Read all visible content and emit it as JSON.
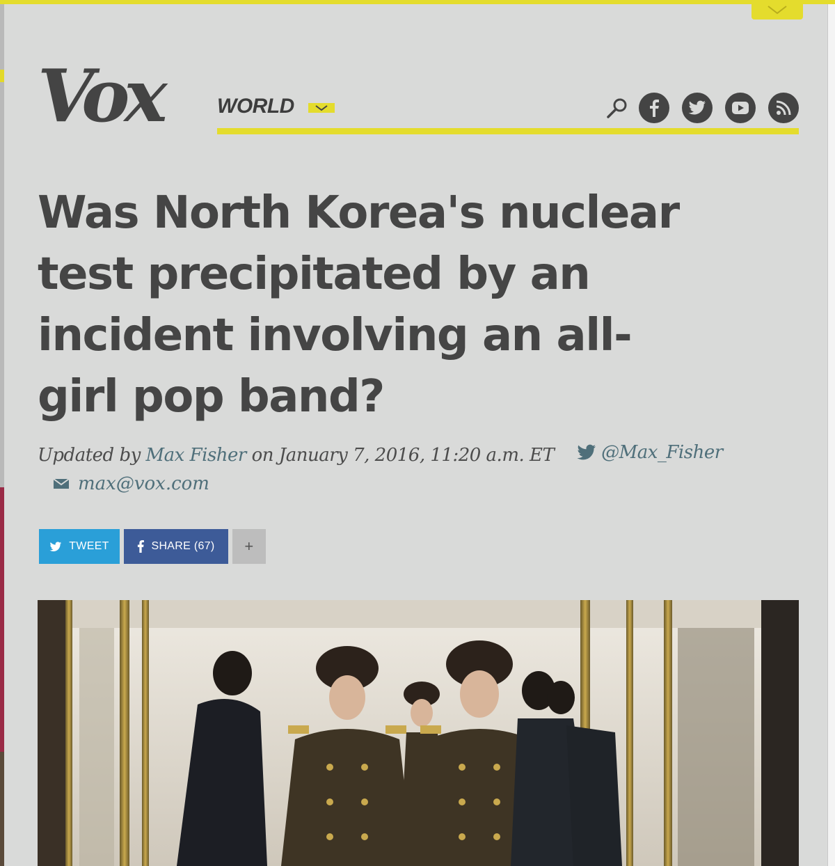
{
  "site": {
    "logo": "Vox"
  },
  "nav": {
    "section": "WORLD"
  },
  "social": {
    "icons": [
      "search-icon",
      "facebook-icon",
      "twitter-icon",
      "youtube-icon",
      "rss-icon"
    ]
  },
  "article": {
    "headline": "Was North Korea's nuclear test precipitated by an incident involving an all-girl pop band?",
    "byline": {
      "updated_by": "Updated by",
      "author": "Max Fisher",
      "on": "on",
      "date": "January 7, 2016, 11:20 a.m. ET",
      "twitter": "@Max_Fisher",
      "email": "max@vox.com"
    }
  },
  "share": {
    "tweet": "TWEET",
    "facebook": "SHARE (67)",
    "more": "+"
  },
  "colors": {
    "accent": "#e4dc2d",
    "background": "#d9dad9",
    "text": "#454545",
    "link": "#4f6f7a",
    "twitter": "#2a9fd8",
    "facebook": "#3d5b98"
  }
}
